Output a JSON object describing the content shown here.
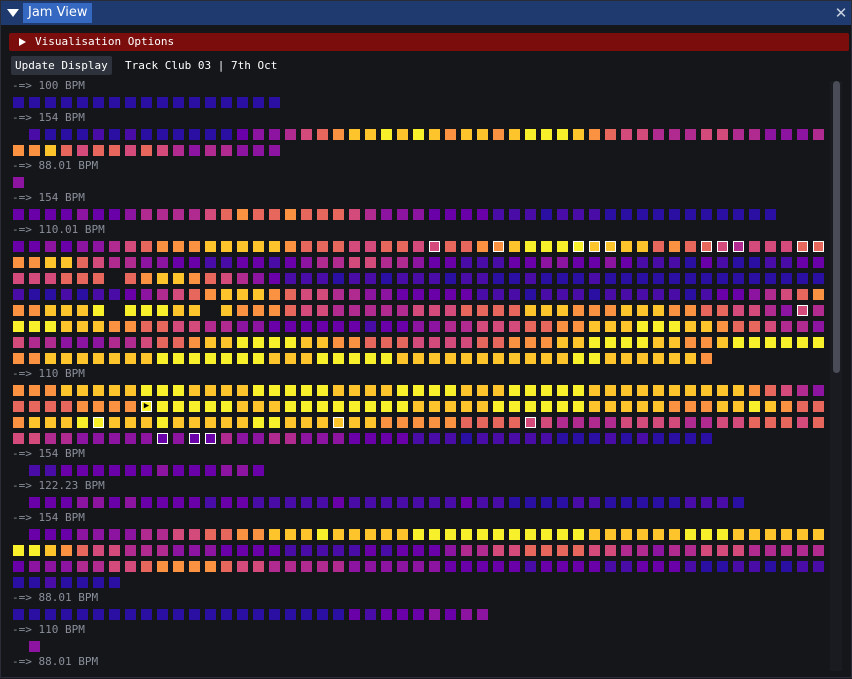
{
  "window": {
    "title": "Jam View",
    "close_icon": "close-icon",
    "collapse_icon": "collapse-triangle-icon"
  },
  "options_header": {
    "label": "Visualisation Options",
    "expand_icon": "expand-triangle-icon"
  },
  "toolbar": {
    "update_button": "Update Display",
    "session_label": "Track Club 03 | 7th Oct"
  },
  "palette": {
    "0": "#2b0fa2",
    "1": "#4a0ca6",
    "2": "#6a00a8",
    "3": "#8d13a1",
    "4": "#b12a90",
    "5": "#d44a7a",
    "6": "#e8675d",
    "7": "#fa9241",
    "8": "#fdc42c",
    "9": "#f7f02a",
    "10": "#f0f921"
  },
  "sections": [
    {
      "bpm": "-=> 100 BPM",
      "rows": [
        {
          "s": 0,
          "c": [
            0,
            0,
            0,
            0,
            0,
            0,
            0,
            0,
            0,
            0,
            0,
            0,
            0,
            0,
            0,
            0,
            0
          ]
        }
      ]
    },
    {
      "bpm": "-=> 154 BPM",
      "rows": [
        {
          "s": 1,
          "c": [
            1,
            0,
            0,
            0,
            1,
            0,
            1,
            0,
            0,
            0,
            0,
            0,
            0,
            2,
            3,
            3,
            4,
            5,
            6,
            7,
            8,
            8,
            9,
            8,
            9,
            8,
            7,
            8,
            8,
            7,
            8,
            9,
            9,
            9,
            8,
            7,
            6,
            5,
            5,
            4,
            4,
            4,
            5,
            5,
            4,
            4,
            3,
            3,
            3,
            4,
            4
          ]
        },
        {
          "s": 0,
          "c": [
            7,
            7,
            8,
            6,
            5,
            6,
            6,
            5,
            6,
            5,
            4,
            3,
            4,
            4,
            3,
            3,
            3
          ]
        }
      ]
    },
    {
      "bpm": "-=> 88.01 BPM",
      "rows": [
        {
          "s": 0,
          "c": [
            3
          ]
        }
      ]
    },
    {
      "bpm": "-=> 154 BPM",
      "rows": [
        {
          "s": 0,
          "c": [
            2,
            2,
            2,
            2,
            3,
            2,
            2,
            3,
            4,
            4,
            4,
            4,
            5,
            6,
            7,
            6,
            6,
            7,
            6,
            6,
            6,
            5,
            4,
            3,
            3,
            3,
            2,
            2,
            2,
            2,
            1,
            1,
            1,
            0,
            1,
            1,
            1,
            0,
            0,
            0,
            0,
            0,
            0,
            0,
            0,
            0,
            0,
            0
          ]
        }
      ]
    },
    {
      "bpm": "-=> 110.01 BPM",
      "rows": [
        {
          "s": 0,
          "c": [
            2,
            2,
            3,
            2,
            3,
            3,
            4,
            5,
            6,
            7,
            7,
            7,
            8,
            8,
            8,
            8,
            8,
            7,
            6,
            6,
            6,
            5,
            5,
            6,
            6,
            5,
            5,
            6,
            6,
            7,
            7,
            8,
            9,
            9,
            9,
            9,
            8,
            8,
            8,
            8,
            6,
            7,
            6,
            6,
            5,
            4,
            5,
            5,
            5,
            6,
            6
          ]
        },
        {
          "s": 0,
          "c": [
            7,
            7,
            8,
            8,
            6,
            5,
            4,
            4,
            3,
            3,
            2,
            2,
            1,
            1,
            2,
            2,
            1,
            2,
            3,
            4,
            4,
            5,
            5,
            4,
            4,
            3,
            2,
            2,
            1,
            1,
            1,
            2,
            2,
            3,
            3,
            2,
            2,
            3,
            2,
            1,
            1,
            1,
            0,
            2,
            1,
            0,
            0,
            1,
            1,
            2,
            2
          ]
        },
        {
          "s": 0,
          "c": [
            5,
            5,
            5,
            6,
            6,
            6,
            -1,
            6,
            7,
            8,
            8,
            7,
            6,
            5,
            4,
            3,
            2,
            1,
            1,
            1,
            0,
            1,
            1,
            0,
            1,
            1,
            1,
            0,
            1,
            1,
            0,
            0,
            1,
            0,
            0,
            0,
            1,
            0,
            0,
            0,
            0,
            0,
            0,
            0,
            0,
            0,
            0,
            0,
            0,
            0,
            0
          ]
        },
        {
          "s": 0,
          "c": [
            1,
            0,
            0,
            1,
            0,
            1,
            1,
            2,
            3,
            4,
            5,
            6,
            7,
            8,
            8,
            8,
            7,
            6,
            5,
            5,
            4,
            4,
            3,
            3,
            2,
            2,
            2,
            2,
            2,
            1,
            1,
            1,
            0,
            1,
            1,
            1,
            0,
            1,
            1,
            1,
            1,
            1,
            0,
            1,
            2,
            2,
            3,
            4,
            5,
            6,
            7
          ]
        },
        {
          "s": 0,
          "c": [
            7,
            7,
            8,
            8,
            8,
            9,
            -1,
            9,
            9,
            9,
            8,
            8,
            -1,
            8,
            7,
            7,
            7,
            6,
            5,
            5,
            4,
            4,
            4,
            4,
            4,
            5,
            5,
            5,
            6,
            6,
            6,
            6,
            8,
            8,
            8,
            7,
            7,
            7,
            8,
            8,
            8,
            7,
            7,
            6,
            6,
            5,
            5,
            4,
            3,
            5,
            4
          ]
        },
        {
          "s": 0,
          "c": [
            9,
            9,
            9,
            8,
            8,
            8,
            7,
            7,
            6,
            6,
            5,
            5,
            4,
            4,
            3,
            3,
            2,
            2,
            2,
            2,
            2,
            2,
            1,
            2,
            2,
            3,
            3,
            4,
            4,
            5,
            5,
            5,
            6,
            6,
            7,
            7,
            8,
            8,
            8,
            9,
            9,
            9,
            8,
            8,
            7,
            6,
            6,
            5,
            4,
            4,
            3
          ]
        },
        {
          "s": 0,
          "c": [
            5,
            4,
            4,
            3,
            3,
            3,
            4,
            4,
            5,
            6,
            6,
            7,
            8,
            8,
            9,
            9,
            9,
            9,
            8,
            8,
            7,
            7,
            6,
            6,
            6,
            5,
            5,
            5,
            5,
            6,
            6,
            7,
            7,
            7,
            8,
            8,
            9,
            9,
            9,
            9,
            8,
            8,
            7,
            7,
            8,
            9,
            9,
            9,
            9,
            9,
            9
          ]
        },
        {
          "s": 0,
          "c": [
            7,
            7,
            8,
            8,
            8,
            8,
            8,
            8,
            8,
            9,
            9,
            9,
            9,
            9,
            9,
            9,
            8,
            8,
            8,
            9,
            9,
            9,
            9,
            9,
            8,
            8,
            8,
            8,
            8,
            8,
            8,
            8,
            8,
            8,
            8,
            9,
            9,
            8,
            8,
            8,
            8,
            8,
            8,
            7
          ]
        }
      ]
    },
    {
      "bpm": "-=> 110 BPM",
      "rows": [
        {
          "s": 0,
          "c": [
            7,
            7,
            7,
            8,
            8,
            8,
            8,
            8,
            9,
            9,
            9,
            8,
            8,
            8,
            8,
            9,
            9,
            9,
            9,
            9,
            8,
            8,
            8,
            8,
            9,
            9,
            9,
            9,
            8,
            8,
            8,
            9,
            9,
            9,
            9,
            9,
            8,
            8,
            8,
            8,
            8,
            8,
            8,
            8,
            8,
            8,
            7,
            6,
            5,
            4,
            3
          ]
        },
        {
          "s": 0,
          "c": [
            6,
            6,
            6,
            6,
            7,
            7,
            7,
            7,
            9,
            9,
            9,
            9,
            9,
            9,
            8,
            8,
            8,
            9,
            9,
            9,
            9,
            9,
            9,
            9,
            9,
            8,
            8,
            8,
            8,
            8,
            9,
            9,
            9,
            9,
            9,
            9,
            8,
            8,
            8,
            8,
            8,
            7,
            7,
            7,
            8,
            8,
            9,
            8,
            7,
            6,
            6
          ]
        },
        {
          "s": 0,
          "c": [
            7,
            8,
            8,
            8,
            9,
            9,
            8,
            8,
            8,
            9,
            8,
            8,
            8,
            8,
            8,
            9,
            9,
            8,
            8,
            8,
            8,
            8,
            8,
            7,
            7,
            7,
            7,
            7,
            6,
            6,
            6,
            6,
            5,
            5,
            4,
            4,
            4,
            4,
            5,
            5,
            5,
            5,
            4,
            4,
            5,
            5,
            6,
            6,
            6,
            5,
            6
          ]
        },
        {
          "s": 0,
          "c": [
            5,
            5,
            4,
            4,
            3,
            3,
            3,
            3,
            3,
            2,
            3,
            2,
            2,
            4,
            3,
            3,
            4,
            4,
            3,
            3,
            3,
            2,
            2,
            2,
            2,
            1,
            1,
            1,
            0,
            1,
            1,
            1,
            1,
            1,
            0,
            0,
            0,
            1,
            0,
            1,
            0,
            0,
            0,
            0
          ]
        }
      ]
    },
    {
      "bpm": "-=> 154 BPM",
      "rows": [
        {
          "s": 1,
          "c": [
            1,
            1,
            2,
            2,
            2,
            2,
            2,
            2,
            3,
            2,
            2,
            2,
            3,
            3,
            2
          ]
        }
      ]
    },
    {
      "bpm": "-=> 122.23 BPM",
      "rows": [
        {
          "s": 1,
          "c": [
            2,
            2,
            2,
            3,
            3,
            2,
            3,
            2,
            2,
            2,
            2,
            1,
            2,
            2,
            1,
            1,
            1,
            1,
            1,
            2,
            1,
            1,
            1,
            1,
            1,
            1,
            1,
            2,
            1,
            1,
            0,
            0,
            0,
            0,
            1,
            1,
            0,
            0,
            0,
            0,
            0,
            1,
            1,
            1,
            0
          ]
        }
      ]
    },
    {
      "bpm": "-=> 154 BPM",
      "rows": [
        {
          "s": 1,
          "c": [
            2,
            2,
            2,
            3,
            3,
            3,
            3,
            4,
            4,
            5,
            5,
            6,
            6,
            7,
            7,
            8,
            8,
            8,
            9,
            8,
            8,
            8,
            8,
            8,
            9,
            9,
            9,
            9,
            9,
            9,
            9,
            9,
            9,
            9,
            9,
            8,
            8,
            8,
            8,
            8,
            8,
            9,
            9,
            9,
            8,
            8,
            8,
            8,
            8,
            8
          ]
        },
        {
          "s": 0,
          "c": [
            9,
            9,
            8,
            7,
            6,
            5,
            5,
            4,
            4,
            4,
            3,
            3,
            3,
            2,
            2,
            2,
            2,
            1,
            1,
            1,
            1,
            1,
            2,
            1,
            2,
            2,
            2,
            3,
            4,
            4,
            5,
            5,
            6,
            6,
            6,
            6,
            5,
            5,
            4,
            4,
            3,
            4,
            4,
            5,
            5,
            5,
            4,
            4,
            4,
            4,
            4
          ]
        },
        {
          "s": 0,
          "c": [
            2,
            3,
            3,
            3,
            4,
            4,
            5,
            5,
            6,
            7,
            7,
            7,
            7,
            6,
            5,
            5,
            4,
            4,
            4,
            4,
            4,
            3,
            3,
            3,
            3,
            3,
            3,
            2,
            2,
            2,
            2,
            2,
            1,
            2,
            2,
            2,
            2,
            1,
            1,
            2,
            2,
            2,
            1,
            0,
            0,
            1,
            1,
            0,
            0,
            1,
            1
          ]
        },
        {
          "s": 0,
          "c": [
            0,
            0,
            1,
            0,
            0,
            0,
            0
          ]
        }
      ]
    },
    {
      "bpm": "-=> 88.01 BPM",
      "rows": [
        {
          "s": 0,
          "c": [
            0,
            0,
            0,
            0,
            0,
            0,
            0,
            0,
            0,
            0,
            0,
            0,
            0,
            0,
            0,
            0,
            0,
            0,
            0,
            0,
            0,
            2,
            1,
            2,
            2,
            2,
            3,
            2,
            3,
            3
          ]
        }
      ]
    },
    {
      "bpm": "-=> 110 BPM",
      "rows": [
        {
          "s": 1,
          "c": [
            3
          ]
        }
      ]
    },
    {
      "bpm": "-=> 88.01 BPM",
      "rows": []
    }
  ],
  "selected": [
    [
      4,
      0,
      26
    ],
    [
      4,
      0,
      30
    ],
    [
      4,
      0,
      35
    ],
    [
      4,
      0,
      36
    ],
    [
      4,
      0,
      37
    ],
    [
      4,
      0,
      43
    ],
    [
      4,
      0,
      44
    ],
    [
      4,
      0,
      45
    ],
    [
      4,
      0,
      49
    ],
    [
      4,
      0,
      50
    ],
    [
      4,
      4,
      49
    ],
    [
      5,
      1,
      8
    ],
    [
      5,
      2,
      5
    ],
    [
      5,
      2,
      20
    ],
    [
      5,
      2,
      32
    ],
    [
      5,
      3,
      9
    ],
    [
      5,
      3,
      11
    ],
    [
      5,
      3,
      12
    ]
  ],
  "play_marker": [
    5,
    1,
    8
  ]
}
